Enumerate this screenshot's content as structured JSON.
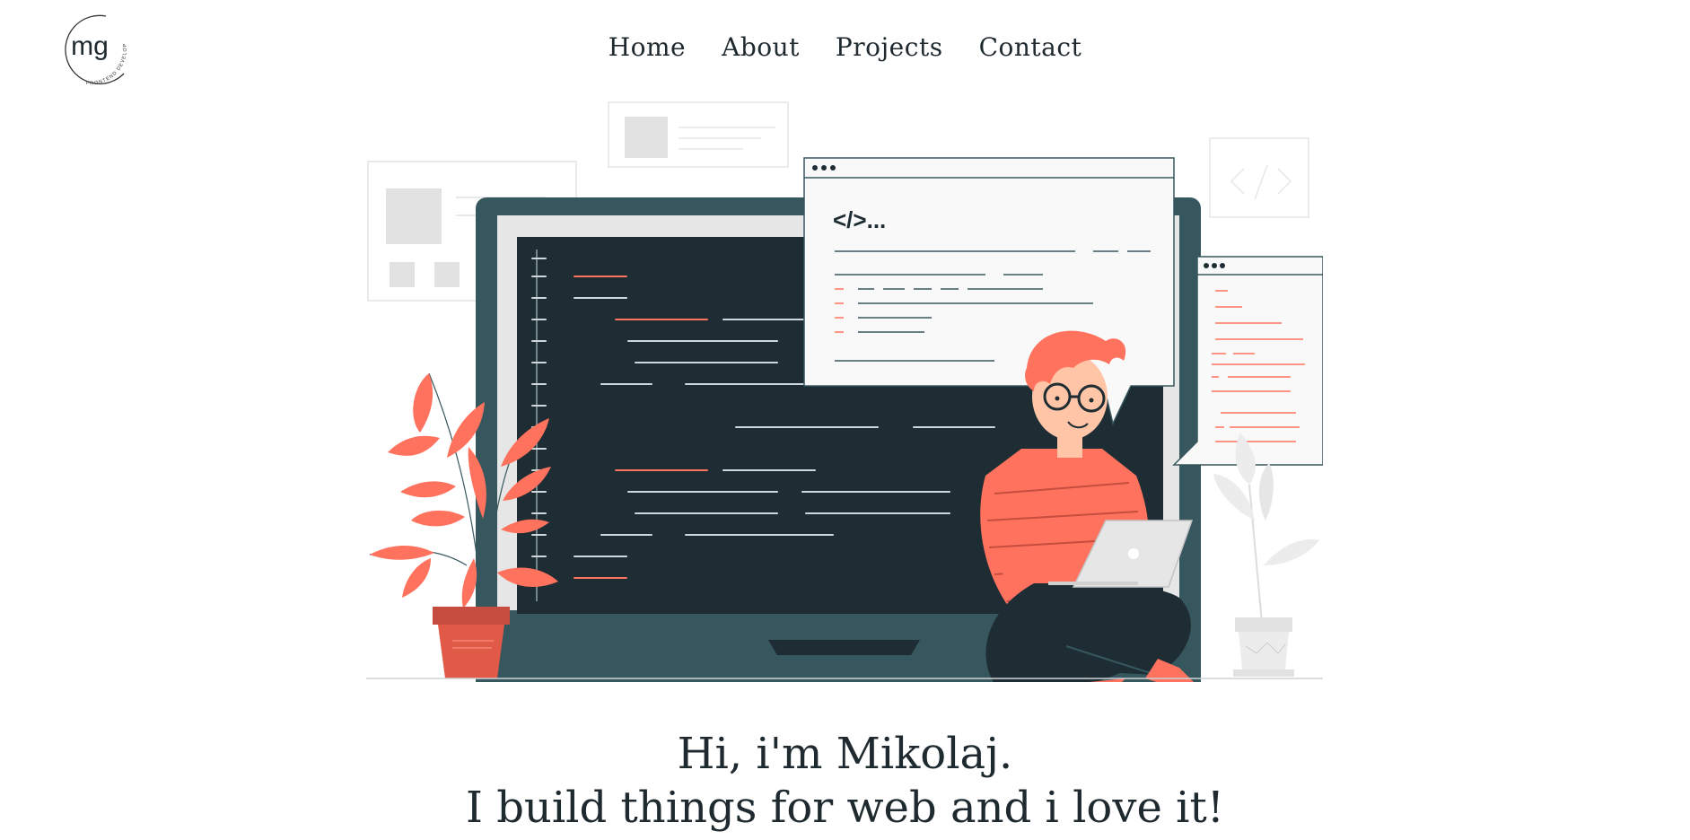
{
  "logo": {
    "initials": "mg",
    "subtitle": "FRONTEND DEVELOPER"
  },
  "nav": {
    "items": [
      {
        "label": "Home"
      },
      {
        "label": "About"
      },
      {
        "label": "Projects"
      },
      {
        "label": "Contact"
      }
    ]
  },
  "illustration": {
    "code_symbol": "</>..."
  },
  "hero": {
    "line1": "Hi, i'm Mikolaj.",
    "line2": "I build things for web and i love it!"
  },
  "colors": {
    "accent": "#ff725e",
    "dark": "#1e2c33",
    "monitor": "#37575f",
    "light": "#e6e6e6"
  }
}
